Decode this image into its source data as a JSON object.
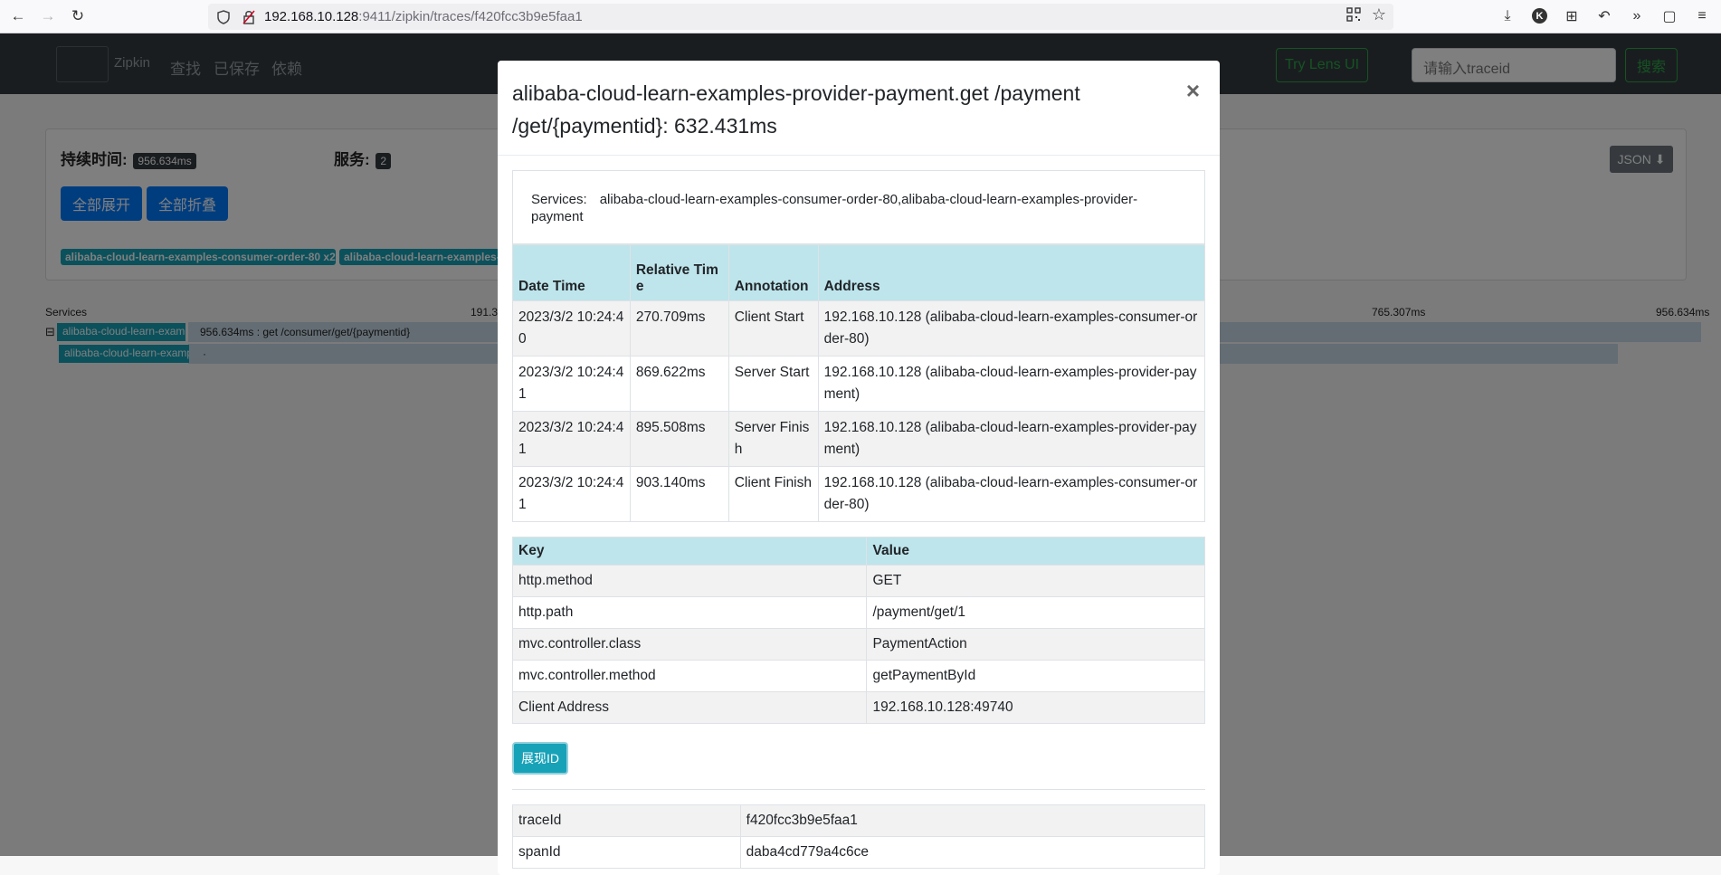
{
  "browser": {
    "url_host": "192.168.10.128",
    "url_rest": ":9411/zipkin/traces/f420fcc3b9e5faa1"
  },
  "navbar": {
    "brand": "Zipkin",
    "links": [
      "查找",
      "已保存",
      "依赖"
    ],
    "lens_button": "Try Lens UI",
    "traceid_placeholder": "请输入traceid",
    "search_button": "搜索"
  },
  "summary": {
    "duration_label": "持续时间:",
    "duration_value": "956.634ms",
    "services_label": "服务:",
    "services_count": "2",
    "expand_all": "全部展开",
    "collapse_all": "全部折叠",
    "json_button": "JSON",
    "service_chips": [
      "alibaba-cloud-learn-examples-consumer-order-80 x2",
      "alibaba-cloud-learn-examples-"
    ]
  },
  "timeline": {
    "services_header": "Services",
    "ticks": [
      "191.32",
      "765.307ms",
      "956.634ms"
    ],
    "rows": [
      {
        "label": "alibaba-cloud-learn-exam",
        "text": "956.634ms : get /consumer/get/{paymentid}"
      },
      {
        "label": "alibaba-cloud-learn-examp",
        "text": "·"
      }
    ]
  },
  "modal": {
    "title": "alibaba-cloud-learn-examples-provider-payment.get /payment /get/{paymentid}: 632.431ms",
    "close": "×",
    "services_label": "Services:",
    "services_value": "alibaba-cloud-learn-examples-consumer-order-80,alibaba-cloud-learn-examples-provider-payment",
    "annotations": {
      "headers": [
        "Date Time",
        "Relative Time",
        "Annotation",
        "Address"
      ],
      "rows": [
        [
          "2023/3/2 10:24:40",
          "270.709ms",
          "Client Start",
          "192.168.10.128 (alibaba-cloud-learn-examples-consumer-order-80)"
        ],
        [
          "2023/3/2 10:24:41",
          "869.622ms",
          "Server Start",
          "192.168.10.128 (alibaba-cloud-learn-examples-provider-payment)"
        ],
        [
          "2023/3/2 10:24:41",
          "895.508ms",
          "Server Finish",
          "192.168.10.128 (alibaba-cloud-learn-examples-provider-payment)"
        ],
        [
          "2023/3/2 10:24:41",
          "903.140ms",
          "Client Finish",
          "192.168.10.128 (alibaba-cloud-learn-examples-consumer-order-80)"
        ]
      ]
    },
    "tags": {
      "headers": [
        "Key",
        "Value"
      ],
      "rows": [
        [
          "http.method",
          "GET"
        ],
        [
          "http.path",
          "/payment/get/1"
        ],
        [
          "mvc.controller.class",
          "PaymentAction"
        ],
        [
          "mvc.controller.method",
          "getPaymentById"
        ],
        [
          "Client Address",
          "192.168.10.128:49740"
        ]
      ]
    },
    "show_ids_button": "展现ID",
    "ids": [
      [
        "traceId",
        "f420fcc3b9e5faa1"
      ],
      [
        "spanId",
        "daba4cd779a4c6ce"
      ]
    ]
  }
}
